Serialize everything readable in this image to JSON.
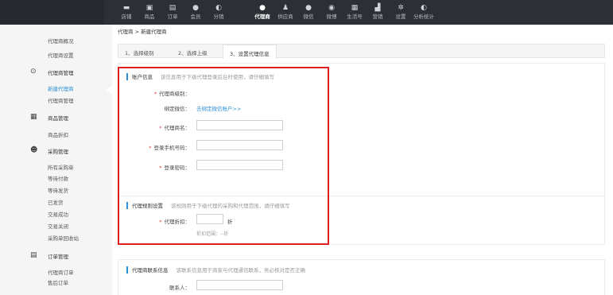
{
  "topnav": {
    "items": [
      {
        "label": "店铺",
        "icon": "store-icon",
        "glyph": "▬"
      },
      {
        "label": "商品",
        "icon": "goods-icon",
        "glyph": "▣"
      },
      {
        "label": "订单",
        "icon": "order-icon",
        "glyph": "▤"
      },
      {
        "label": "会员",
        "icon": "member-icon",
        "glyph": "●"
      },
      {
        "label": "分销",
        "icon": "distribution-icon",
        "glyph": "◐"
      },
      {
        "label": "代理商",
        "icon": "agent-icon",
        "glyph": "●"
      },
      {
        "label": "供应商",
        "icon": "supplier-icon",
        "glyph": "♟"
      },
      {
        "label": "微信",
        "icon": "wechat-icon",
        "glyph": "●"
      },
      {
        "label": "微博",
        "icon": "weibo-icon",
        "glyph": "◉"
      },
      {
        "label": "生活号",
        "icon": "life-account-icon",
        "glyph": "▦"
      },
      {
        "label": "营销",
        "icon": "marketing-icon",
        "glyph": "▟"
      },
      {
        "label": "设置",
        "icon": "settings-icon",
        "glyph": "✲"
      },
      {
        "label": "分析统计",
        "icon": "analytics-icon",
        "glyph": "◐"
      }
    ],
    "active_index": 5
  },
  "sidebar": {
    "groups": [
      {
        "label": "",
        "icon": "",
        "items": [
          "代理商概况",
          "代理商设置"
        ]
      },
      {
        "label": "代理商管理",
        "icon": "agent-manage-icon",
        "glyph": "⊙",
        "items": [
          "新建代理商",
          "代理商管理"
        ]
      },
      {
        "label": "商品管理",
        "icon": "goods-manage-icon",
        "glyph": "▦",
        "items": [
          "商品折扣"
        ]
      },
      {
        "label": "采购管理",
        "icon": "purchase-manage-icon",
        "glyph": "☻",
        "items": [
          "所有采购单",
          "等待付款",
          "等待发货",
          "已发货",
          "交易成功",
          "交易关闭",
          "采购单回收站"
        ]
      },
      {
        "label": "订单管理",
        "icon": "order-manage-icon",
        "glyph": "▤",
        "items": [
          "代理商订单",
          "售后订单"
        ]
      }
    ],
    "active_item": "新建代理商"
  },
  "breadcrumb": "代理商 > 新建代理商",
  "steps": [
    "1、选择级别",
    "2、选择上级",
    "3、设置代理信息"
  ],
  "active_step": 2,
  "account_section": {
    "title": "账户信息",
    "hint": "该信息用于下级代理登录后台时使用，请仔细填写",
    "agent_level_label": "代理商级别：",
    "bind_wechat_label": "绑定微信：",
    "bind_wechat_link": "去绑定微信账户>>",
    "agent_name_label": "代理商名：",
    "agent_name_value": "",
    "phone_label": "登录手机号码：",
    "phone_value": "",
    "password_label": "登录密码：",
    "password_value": ""
  },
  "rules_section": {
    "title": "代理规则设置",
    "hint": "该规则用于下级代理的采购和代理范围，请仔细填写",
    "discount_label": "代理折扣：",
    "discount_value": "",
    "discount_unit": "折",
    "discount_range": "折扣范围：--折"
  },
  "contact_section": {
    "title": "代理商联系信息",
    "hint": "该联系信息用于商家与代理通讯联系，务必核对是否正确",
    "contact_label": "联系人：",
    "contact_value": ""
  },
  "required_mark": "*",
  "colors": {
    "nav_bg": "#2c2f36",
    "accent": "#2d8fd5",
    "highlight_border": "#e02020",
    "required": "#e4393c"
  }
}
